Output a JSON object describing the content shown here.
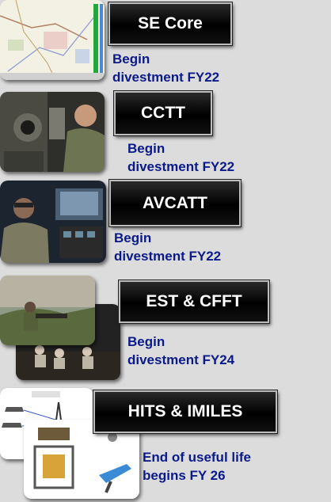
{
  "systems": [
    {
      "name": "SE Core",
      "status_line1": "Begin",
      "status_line2": "divestment FY22"
    },
    {
      "name": "CCTT",
      "status_line1": "Begin",
      "status_line2": "divestment FY22"
    },
    {
      "name": "AVCATT",
      "status_line1": "Begin",
      "status_line2": "divestment FY22"
    },
    {
      "name": "EST & CFFT",
      "status_line1": "Begin",
      "status_line2": "divestment FY24"
    },
    {
      "name": "HITS & IMILES",
      "status_line1": "End of useful life",
      "status_line2": "begins FY 26"
    }
  ],
  "colors": {
    "status_text": "#0b1a8a",
    "label_bg": "#000000",
    "page_bg": "#dcdcdc"
  }
}
